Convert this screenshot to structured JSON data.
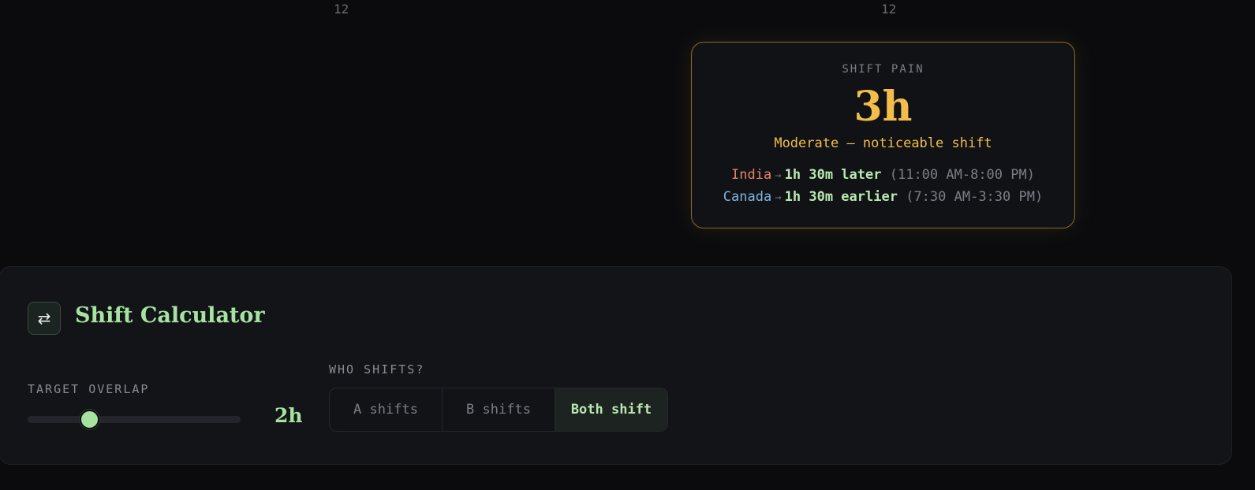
{
  "axis_ticks": [
    "12",
    "12"
  ],
  "shift_pain": {
    "label": "SHIFT PAIN",
    "value": "3h",
    "description": "Moderate — noticeable shift",
    "lines": [
      {
        "who": "India",
        "arrow": "→",
        "amount": "1h 30m later",
        "range": "(11:00 AM-8:00 PM)"
      },
      {
        "who": "Canada",
        "arrow": "→",
        "amount": "1h 30m earlier",
        "range": "(7:30 AM-3:30 PM)"
      }
    ]
  },
  "calculator": {
    "icon": "swap-arrows-icon",
    "icon_glyph": "⇄",
    "title": "Shift Calculator",
    "overlap": {
      "label": "TARGET OVERLAP",
      "value_text": "2h",
      "slider_fraction": 0.29
    },
    "who_shifts": {
      "label": "WHO SHIFTS?",
      "options": [
        "A shifts",
        "B shifts",
        "Both shift"
      ],
      "selected": "Both shift"
    }
  },
  "colors": {
    "accent_green": "#a6e3a1",
    "accent_amber": "#f2bd4a",
    "person_a": "#e8826a",
    "person_b": "#7fb5e0"
  }
}
